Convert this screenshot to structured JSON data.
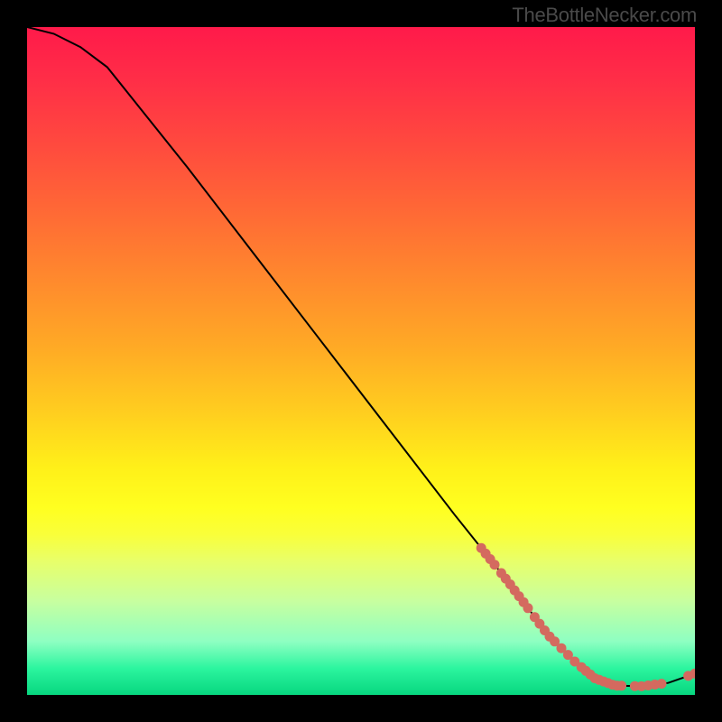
{
  "watermark": "TheBottleNecker.com",
  "chart_data": {
    "type": "line",
    "title": "",
    "xlabel": "",
    "ylabel": "",
    "xlim": [
      0,
      100
    ],
    "ylim": [
      0,
      100
    ],
    "curve": [
      {
        "x": 0,
        "y": 100
      },
      {
        "x": 4,
        "y": 99
      },
      {
        "x": 8,
        "y": 97
      },
      {
        "x": 12,
        "y": 94
      },
      {
        "x": 16,
        "y": 89
      },
      {
        "x": 24,
        "y": 79
      },
      {
        "x": 34,
        "y": 66
      },
      {
        "x": 44,
        "y": 53
      },
      {
        "x": 54,
        "y": 40
      },
      {
        "x": 64,
        "y": 27
      },
      {
        "x": 72,
        "y": 17
      },
      {
        "x": 78,
        "y": 9
      },
      {
        "x": 82,
        "y": 5
      },
      {
        "x": 85,
        "y": 2.5
      },
      {
        "x": 88,
        "y": 1.4
      },
      {
        "x": 92,
        "y": 1.3
      },
      {
        "x": 96,
        "y": 1.8
      },
      {
        "x": 100,
        "y": 3.2
      }
    ],
    "marker_clusters": [
      {
        "start_x": 68,
        "end_x": 70,
        "y_start": 22,
        "y_end": 19,
        "count": 4
      },
      {
        "start_x": 71,
        "end_x": 75,
        "y_start": 18,
        "y_end": 12,
        "count": 7
      },
      {
        "start_x": 76,
        "end_x": 79,
        "y_start": 11,
        "y_end": 8,
        "count": 5
      },
      {
        "start_x": 80,
        "end_x": 82,
        "y_start": 7,
        "y_end": 5,
        "count": 3
      },
      {
        "start_x": 83,
        "end_x": 89,
        "y_start": 3,
        "y_end": 1.5,
        "count": 10
      },
      {
        "start_x": 91,
        "end_x": 95,
        "y_start": 1.4,
        "y_end": 1.5,
        "count": 5
      },
      {
        "start_x": 99,
        "end_x": 100,
        "y_start": 2.8,
        "y_end": 3.2,
        "count": 2
      }
    ],
    "marker_color": "#d46a5f",
    "marker_radius": 5.5,
    "curve_color": "#000000",
    "curve_width": 2
  }
}
